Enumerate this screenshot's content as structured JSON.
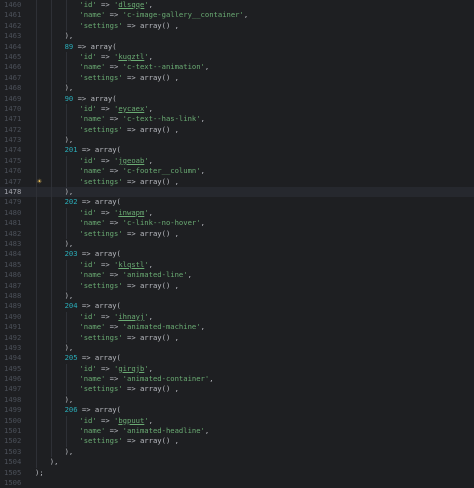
{
  "editor": {
    "current_line": 1478,
    "lines": [
      {
        "no": 1460,
        "indent": 3,
        "parts": [
          [
            "s",
            "'id'"
          ],
          [
            "op",
            " => "
          ],
          [
            "s",
            "'",
            "dlsqqe",
            "'"
          ],
          [
            "op",
            ","
          ]
        ]
      },
      {
        "no": 1461,
        "indent": 3,
        "parts": [
          [
            "s",
            "'name'"
          ],
          [
            "op",
            " => "
          ],
          [
            "s",
            "'c-image-gallery__container'"
          ],
          [
            "op",
            ","
          ]
        ]
      },
      {
        "no": 1462,
        "indent": 3,
        "parts": [
          [
            "s",
            "'settings'"
          ],
          [
            "op",
            " => "
          ],
          [
            "fn",
            "array()"
          ],
          [
            "op",
            " ,"
          ]
        ]
      },
      {
        "no": 1463,
        "indent": 2,
        "parts": [
          [
            "op",
            "),"
          ]
        ]
      },
      {
        "no": 1464,
        "indent": 2,
        "parts": [
          [
            "n",
            "89"
          ],
          [
            "op",
            " => "
          ],
          [
            "fn",
            "array("
          ]
        ]
      },
      {
        "no": 1465,
        "indent": 3,
        "parts": [
          [
            "s",
            "'id'"
          ],
          [
            "op",
            " => "
          ],
          [
            "s",
            "'",
            "kugztl",
            "'"
          ],
          [
            "op",
            ","
          ]
        ]
      },
      {
        "no": 1466,
        "indent": 3,
        "parts": [
          [
            "s",
            "'name'"
          ],
          [
            "op",
            " => "
          ],
          [
            "s",
            "'c-text--animation'"
          ],
          [
            "op",
            ","
          ]
        ]
      },
      {
        "no": 1467,
        "indent": 3,
        "parts": [
          [
            "s",
            "'settings'"
          ],
          [
            "op",
            " => "
          ],
          [
            "fn",
            "array()"
          ],
          [
            "op",
            " ,"
          ]
        ]
      },
      {
        "no": 1468,
        "indent": 2,
        "parts": [
          [
            "op",
            "),"
          ]
        ]
      },
      {
        "no": 1469,
        "indent": 2,
        "parts": [
          [
            "n",
            "90"
          ],
          [
            "op",
            " => "
          ],
          [
            "fn",
            "array("
          ]
        ]
      },
      {
        "no": 1470,
        "indent": 3,
        "parts": [
          [
            "s",
            "'id'"
          ],
          [
            "op",
            " => "
          ],
          [
            "s",
            "'",
            "eycaex",
            "'"
          ],
          [
            "op",
            ","
          ]
        ]
      },
      {
        "no": 1471,
        "indent": 3,
        "parts": [
          [
            "s",
            "'name'"
          ],
          [
            "op",
            " => "
          ],
          [
            "s",
            "'c-text--has-link'"
          ],
          [
            "op",
            ","
          ]
        ]
      },
      {
        "no": 1472,
        "indent": 3,
        "parts": [
          [
            "s",
            "'settings'"
          ],
          [
            "op",
            " => "
          ],
          [
            "fn",
            "array()"
          ],
          [
            "op",
            " ,"
          ]
        ]
      },
      {
        "no": 1473,
        "indent": 2,
        "parts": [
          [
            "op",
            "),"
          ]
        ]
      },
      {
        "no": 1474,
        "indent": 2,
        "parts": [
          [
            "n",
            "201"
          ],
          [
            "op",
            " => "
          ],
          [
            "fn",
            "array("
          ]
        ]
      },
      {
        "no": 1475,
        "indent": 3,
        "parts": [
          [
            "s",
            "'id'"
          ],
          [
            "op",
            " => "
          ],
          [
            "s",
            "'",
            "jgeoab",
            "'"
          ],
          [
            "op",
            ","
          ]
        ]
      },
      {
        "no": 1476,
        "indent": 3,
        "parts": [
          [
            "s",
            "'name'"
          ],
          [
            "op",
            " => "
          ],
          [
            "s",
            "'c-footer__column'"
          ],
          [
            "op",
            ","
          ]
        ]
      },
      {
        "no": 1477,
        "indent": 3,
        "bulb": true,
        "parts": [
          [
            "s",
            "'settings'"
          ],
          [
            "op",
            " => "
          ],
          [
            "fn",
            "array()"
          ],
          [
            "op",
            " ,"
          ]
        ]
      },
      {
        "no": 1478,
        "indent": 2,
        "parts": [
          [
            "op",
            "),"
          ]
        ]
      },
      {
        "no": 1479,
        "indent": 2,
        "parts": [
          [
            "n",
            "202"
          ],
          [
            "op",
            " => "
          ],
          [
            "fn",
            "array("
          ]
        ]
      },
      {
        "no": 1480,
        "indent": 3,
        "parts": [
          [
            "s",
            "'id'"
          ],
          [
            "op",
            " => "
          ],
          [
            "s",
            "'",
            "inwapm",
            "'"
          ],
          [
            "op",
            ","
          ]
        ]
      },
      {
        "no": 1481,
        "indent": 3,
        "parts": [
          [
            "s",
            "'name'"
          ],
          [
            "op",
            " => "
          ],
          [
            "s",
            "'c-link--no-hover'"
          ],
          [
            "op",
            ","
          ]
        ]
      },
      {
        "no": 1482,
        "indent": 3,
        "parts": [
          [
            "s",
            "'settings'"
          ],
          [
            "op",
            " => "
          ],
          [
            "fn",
            "array()"
          ],
          [
            "op",
            " ,"
          ]
        ]
      },
      {
        "no": 1483,
        "indent": 2,
        "parts": [
          [
            "op",
            "),"
          ]
        ]
      },
      {
        "no": 1484,
        "indent": 2,
        "parts": [
          [
            "n",
            "203"
          ],
          [
            "op",
            " => "
          ],
          [
            "fn",
            "array("
          ]
        ]
      },
      {
        "no": 1485,
        "indent": 3,
        "parts": [
          [
            "s",
            "'id'"
          ],
          [
            "op",
            " => "
          ],
          [
            "s",
            "'",
            "klqstl",
            "'"
          ],
          [
            "op",
            ","
          ]
        ]
      },
      {
        "no": 1486,
        "indent": 3,
        "parts": [
          [
            "s",
            "'name'"
          ],
          [
            "op",
            " => "
          ],
          [
            "s",
            "'animated-line'"
          ],
          [
            "op",
            ","
          ]
        ]
      },
      {
        "no": 1487,
        "indent": 3,
        "parts": [
          [
            "s",
            "'settings'"
          ],
          [
            "op",
            " => "
          ],
          [
            "fn",
            "array()"
          ],
          [
            "op",
            " ,"
          ]
        ]
      },
      {
        "no": 1488,
        "indent": 2,
        "parts": [
          [
            "op",
            "),"
          ]
        ]
      },
      {
        "no": 1489,
        "indent": 2,
        "parts": [
          [
            "n",
            "204"
          ],
          [
            "op",
            " => "
          ],
          [
            "fn",
            "array("
          ]
        ]
      },
      {
        "no": 1490,
        "indent": 3,
        "parts": [
          [
            "s",
            "'id'"
          ],
          [
            "op",
            " => "
          ],
          [
            "s",
            "'",
            "ihnayj",
            "'"
          ],
          [
            "op",
            ","
          ]
        ]
      },
      {
        "no": 1491,
        "indent": 3,
        "parts": [
          [
            "s",
            "'name'"
          ],
          [
            "op",
            " => "
          ],
          [
            "s",
            "'animated-machine'"
          ],
          [
            "op",
            ","
          ]
        ]
      },
      {
        "no": 1492,
        "indent": 3,
        "parts": [
          [
            "s",
            "'settings'"
          ],
          [
            "op",
            " => "
          ],
          [
            "fn",
            "array()"
          ],
          [
            "op",
            " ,"
          ]
        ]
      },
      {
        "no": 1493,
        "indent": 2,
        "parts": [
          [
            "op",
            "),"
          ]
        ]
      },
      {
        "no": 1494,
        "indent": 2,
        "parts": [
          [
            "n",
            "205"
          ],
          [
            "op",
            " => "
          ],
          [
            "fn",
            "array("
          ]
        ]
      },
      {
        "no": 1495,
        "indent": 3,
        "parts": [
          [
            "s",
            "'id'"
          ],
          [
            "op",
            " => "
          ],
          [
            "s",
            "'",
            "girqjb",
            "'"
          ],
          [
            "op",
            ","
          ]
        ]
      },
      {
        "no": 1496,
        "indent": 3,
        "parts": [
          [
            "s",
            "'name'"
          ],
          [
            "op",
            " => "
          ],
          [
            "s",
            "'animated-container'"
          ],
          [
            "op",
            ","
          ]
        ]
      },
      {
        "no": 1497,
        "indent": 3,
        "parts": [
          [
            "s",
            "'settings'"
          ],
          [
            "op",
            " => "
          ],
          [
            "fn",
            "array()"
          ],
          [
            "op",
            " ,"
          ]
        ]
      },
      {
        "no": 1498,
        "indent": 2,
        "parts": [
          [
            "op",
            "),"
          ]
        ]
      },
      {
        "no": 1499,
        "indent": 2,
        "parts": [
          [
            "n",
            "206"
          ],
          [
            "op",
            " => "
          ],
          [
            "fn",
            "array("
          ]
        ]
      },
      {
        "no": 1500,
        "indent": 3,
        "parts": [
          [
            "s",
            "'id'"
          ],
          [
            "op",
            " => "
          ],
          [
            "s",
            "'",
            "bgpuut",
            "'"
          ],
          [
            "op",
            ","
          ]
        ]
      },
      {
        "no": 1501,
        "indent": 3,
        "parts": [
          [
            "s",
            "'name'"
          ],
          [
            "op",
            " => "
          ],
          [
            "s",
            "'animated-headline'"
          ],
          [
            "op",
            ","
          ]
        ]
      },
      {
        "no": 1502,
        "indent": 3,
        "parts": [
          [
            "s",
            "'settings'"
          ],
          [
            "op",
            " => "
          ],
          [
            "fn",
            "array()"
          ],
          [
            "op",
            " ,"
          ]
        ]
      },
      {
        "no": 1503,
        "indent": 2,
        "parts": [
          [
            "op",
            "),"
          ]
        ]
      },
      {
        "no": 1504,
        "indent": 1,
        "parts": [
          [
            "op",
            "),"
          ]
        ]
      },
      {
        "no": 1505,
        "indent": 0,
        "parts": [
          [
            "op",
            ");"
          ]
        ]
      },
      {
        "no": 1506,
        "indent": 0,
        "parts": []
      }
    ]
  },
  "colors": {
    "background": "#1e1f22",
    "string": "#6aab73",
    "number": "#2aacb8",
    "text": "#bcbec4",
    "gutter": "#4b5059",
    "current_line": "#26282e"
  },
  "icons": {
    "intention_bulb": "lightbulb-icon"
  }
}
